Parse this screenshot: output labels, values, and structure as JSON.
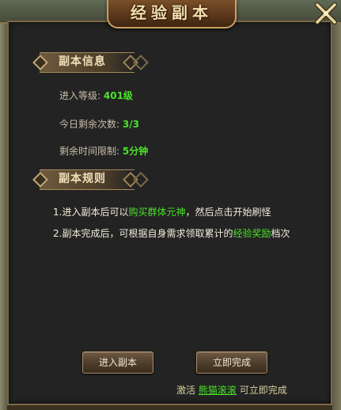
{
  "window": {
    "title": "经验副本",
    "close_label": "关闭"
  },
  "info_section": {
    "header": "副本信息",
    "rows": [
      {
        "label": "进入等级:",
        "value": "401级"
      },
      {
        "label": "今日剩余次数:",
        "value": "3/3"
      },
      {
        "label": "剩余时间限制:",
        "value": "5分钟"
      }
    ]
  },
  "rules_section": {
    "header": "副本规则",
    "rule1": {
      "prefix": "1.进入副本后可以",
      "highlight": "购买群体元神",
      "suffix": "，然后点击开始刷怪"
    },
    "rule2": {
      "prefix": "2.副本完成后，可根据自身需求领取累计的",
      "highlight": "经验奖励",
      "suffix": "档次"
    }
  },
  "buttons": {
    "enter": "进入副本",
    "complete": "立即完成"
  },
  "bottom_note": {
    "prefix": "激活",
    "link": "熊猫滚滚",
    "suffix": "可立即完成"
  },
  "colors": {
    "highlight_green": "#49e22a",
    "title_gold": "#f3dfae",
    "panel_bg": "#232323"
  }
}
